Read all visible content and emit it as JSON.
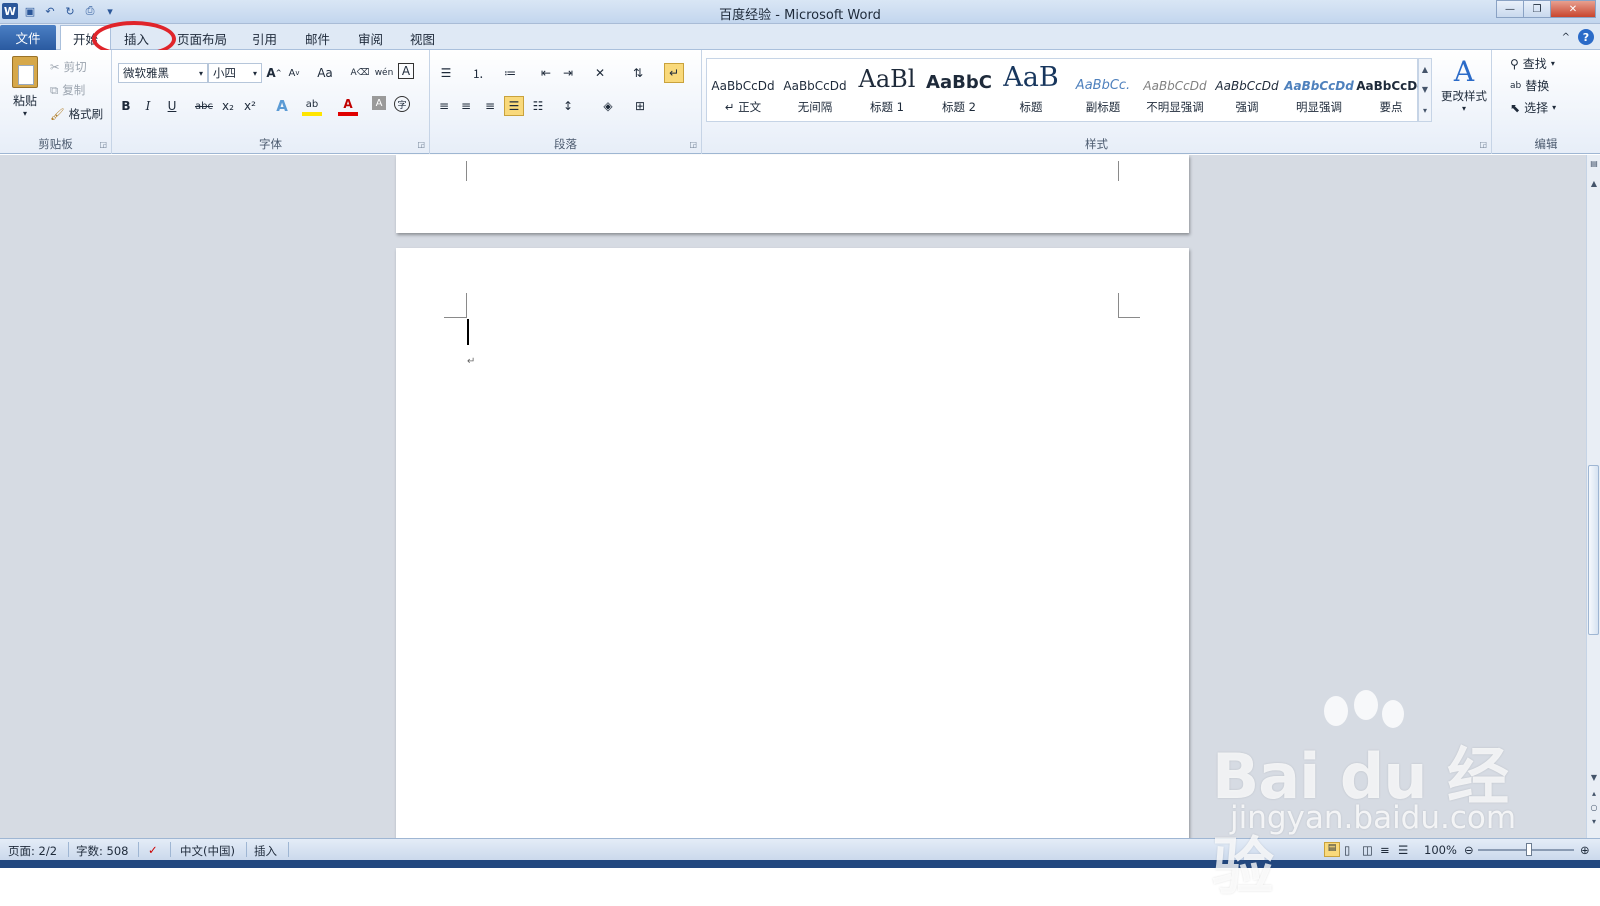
{
  "window": {
    "title": "百度经验 - Microsoft Word",
    "app_letter": "W"
  },
  "tabs": {
    "file": "文件",
    "home": "开始",
    "insert": "插入",
    "layout": "页面布局",
    "references": "引用",
    "mailings": "邮件",
    "review": "审阅",
    "view": "视图"
  },
  "clipboard": {
    "paste": "粘贴",
    "cut": "剪切",
    "copy": "复制",
    "format_painter": "格式刷",
    "label": "剪贴板"
  },
  "font": {
    "name": "微软雅黑",
    "size": "小四",
    "label": "字体",
    "grow": "A",
    "shrink": "A",
    "change_case": "Aa",
    "bold": "B",
    "italic": "I",
    "underline": "U",
    "strike": "abc",
    "subscript": "x₂",
    "superscript": "x²",
    "effects": "A",
    "highlight": "ab",
    "color": "A",
    "shading": "A",
    "phonetic": "wén",
    "enclose": "字",
    "border": "A"
  },
  "paragraph": {
    "label": "段落"
  },
  "styles": {
    "label": "样式",
    "items": [
      {
        "preview": "AaBbCcDd",
        "name": "↵ 正文"
      },
      {
        "preview": "AaBbCcDd",
        "name": "无间隔"
      },
      {
        "preview": "AaBl",
        "name": "标题 1"
      },
      {
        "preview": "AaBbC",
        "name": "标题 2"
      },
      {
        "preview": "AaB",
        "name": "标题"
      },
      {
        "preview": "AaBbCc.",
        "name": "副标题"
      },
      {
        "preview": "AaBbCcDd",
        "name": "不明显强调"
      },
      {
        "preview": "AaBbCcDd",
        "name": "强调"
      },
      {
        "preview": "AaBbCcDd",
        "name": "明显强调"
      },
      {
        "preview": "AaBbCcDd",
        "name": "要点"
      }
    ],
    "change_styles": "更改样式"
  },
  "editing": {
    "label": "编辑",
    "find": "查找",
    "replace": "替换",
    "select": "选择"
  },
  "document": {
    "paragraph_mark": "↵"
  },
  "status": {
    "page": "页面: 2/2",
    "words": "字数: 508",
    "language": "中文(中国)",
    "mode": "插入",
    "zoom": "100%"
  },
  "watermark": {
    "logo": "Bai du 经验",
    "url": "jingyan.baidu.com"
  },
  "colors": {
    "accent": "#2b579a",
    "annotation": "#e0242a",
    "workspace": "#d6dbe3"
  }
}
